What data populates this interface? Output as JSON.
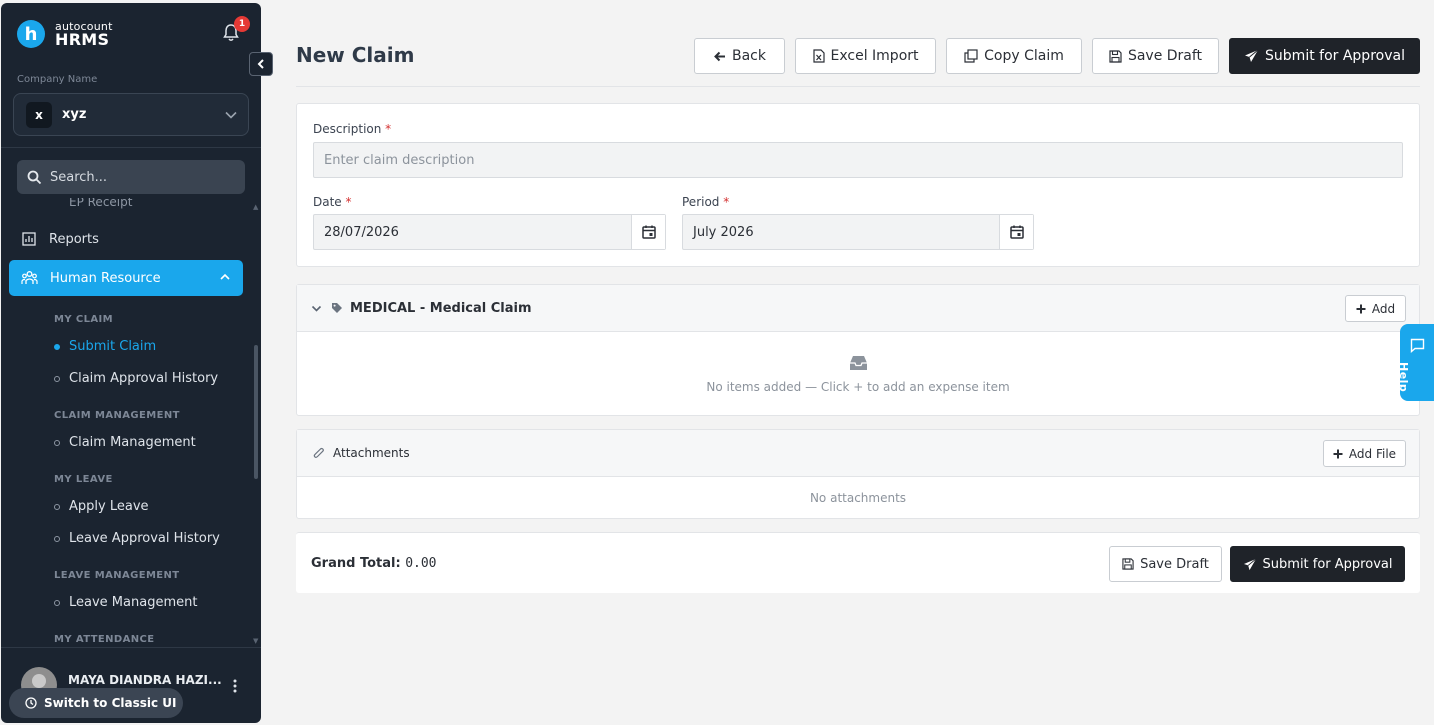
{
  "brand": {
    "small": "autocount",
    "big": "HRMS",
    "logo_letter": "h"
  },
  "notifications": {
    "count": "1"
  },
  "company": {
    "label": "Company Name",
    "initial": "x",
    "name": "xyz"
  },
  "search": {
    "placeholder": "Search..."
  },
  "nav": {
    "clipped_item": "EP Receipt",
    "reports": "Reports",
    "human_resource": "Human Resource",
    "sections": {
      "my_claim": "MY CLAIM",
      "claim_management": "CLAIM MANAGEMENT",
      "my_leave": "MY LEAVE",
      "leave_management": "LEAVE MANAGEMENT",
      "my_attendance": "MY ATTENDANCE"
    },
    "items": {
      "submit_claim": "Submit Claim",
      "claim_approval_history": "Claim Approval History",
      "claim_management": "Claim Management",
      "apply_leave": "Apply Leave",
      "leave_approval_history": "Leave Approval History",
      "leave_management": "Leave Management"
    }
  },
  "user": {
    "name": "MAYA DIANDRA HAZI..."
  },
  "classic_ui": "Switch to Classic UI",
  "page": {
    "title": "New Claim"
  },
  "toolbar": {
    "back": "Back",
    "excel_import": "Excel Import",
    "copy_claim": "Copy Claim",
    "save_draft": "Save Draft",
    "submit": "Submit for Approval"
  },
  "form": {
    "description_label": "Description",
    "description_placeholder": "Enter claim description",
    "date_label": "Date",
    "date_value": "28/07/2026",
    "period_label": "Period",
    "period_value": "July 2026",
    "required_mark": "*"
  },
  "claim_section": {
    "title": "MEDICAL - Medical Claim",
    "add": "Add",
    "empty": "No items added — Click + to add an expense item"
  },
  "attachments": {
    "title": "Attachments",
    "add_file": "Add File",
    "empty": "No attachments"
  },
  "footer": {
    "grand_total_label": "Grand Total:",
    "grand_total_value": "0.00",
    "save_draft": "Save Draft",
    "submit": "Submit for Approval"
  },
  "help": {
    "label": "Help"
  },
  "colors": {
    "accent": "#1aa7ec",
    "sidebar_bg": "#1b2430",
    "primary_button": "#1f2329",
    "required": "#d32f2f"
  }
}
